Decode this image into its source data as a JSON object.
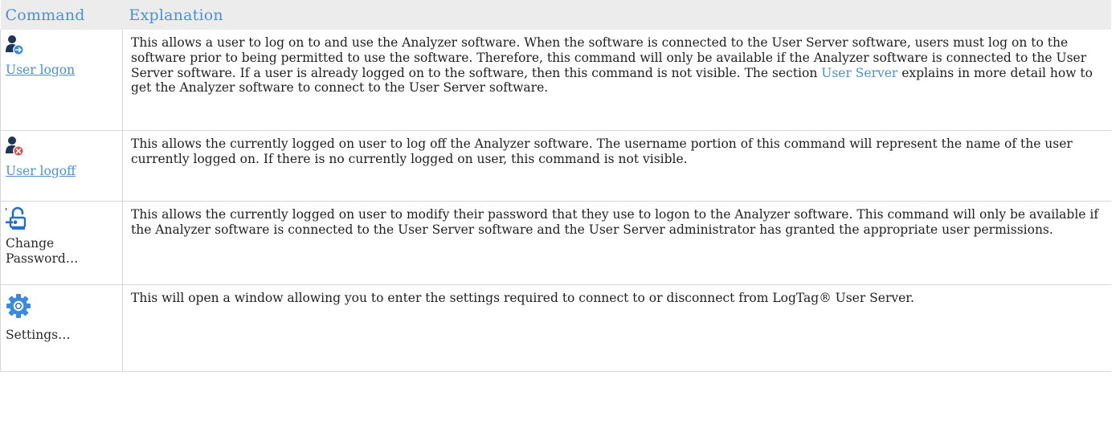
{
  "table": {
    "headers": {
      "command": "Command",
      "explanation": "Explanation"
    },
    "rows": [
      {
        "icon": "user-logon-icon",
        "command_label": "User logon",
        "description_part1": "This allows a user to log on to and use the Analyzer software. When the software is connected to the User Server software, users must log on to the software prior to being permitted to use the software. Therefore, this command will only be available if the Analyzer software is connected to the User Server software. If a user is already logged on to the software, then this command is not visible. The section ",
        "description_link": "User Server",
        "description_part2": " explains in more detail how to get the Analyzer software to connect to the User Server software."
      },
      {
        "icon": "user-logoff-icon",
        "command_label": "User logoff",
        "description": "This allows the currently logged on user to log off the Analyzer software. The username portion of this command will represent the name of the user currently logged on. If there is no currently logged on user, this command is not visible."
      },
      {
        "icon": "change-password-icon",
        "command_label": "Change Password…",
        "description": "This allows the currently logged on user to modify their password that they use to logon to the Analyzer software. This command will only be available if the Analyzer software is connected to the User Server software and the User Server administrator has granted the appropriate user permissions."
      },
      {
        "icon": "settings-gear-icon",
        "command_label": "Settings…",
        "description": "This will open a window allowing you to enter the settings required to connect to or disconnect from LogTag® User Server."
      }
    ]
  },
  "colors": {
    "header_bg": "#ececec",
    "header_text": "#4a90d9",
    "link": "#4a90d9",
    "icon_dark": "#1d3557",
    "icon_blue": "#3a8be0",
    "icon_red": "#d9534f"
  }
}
